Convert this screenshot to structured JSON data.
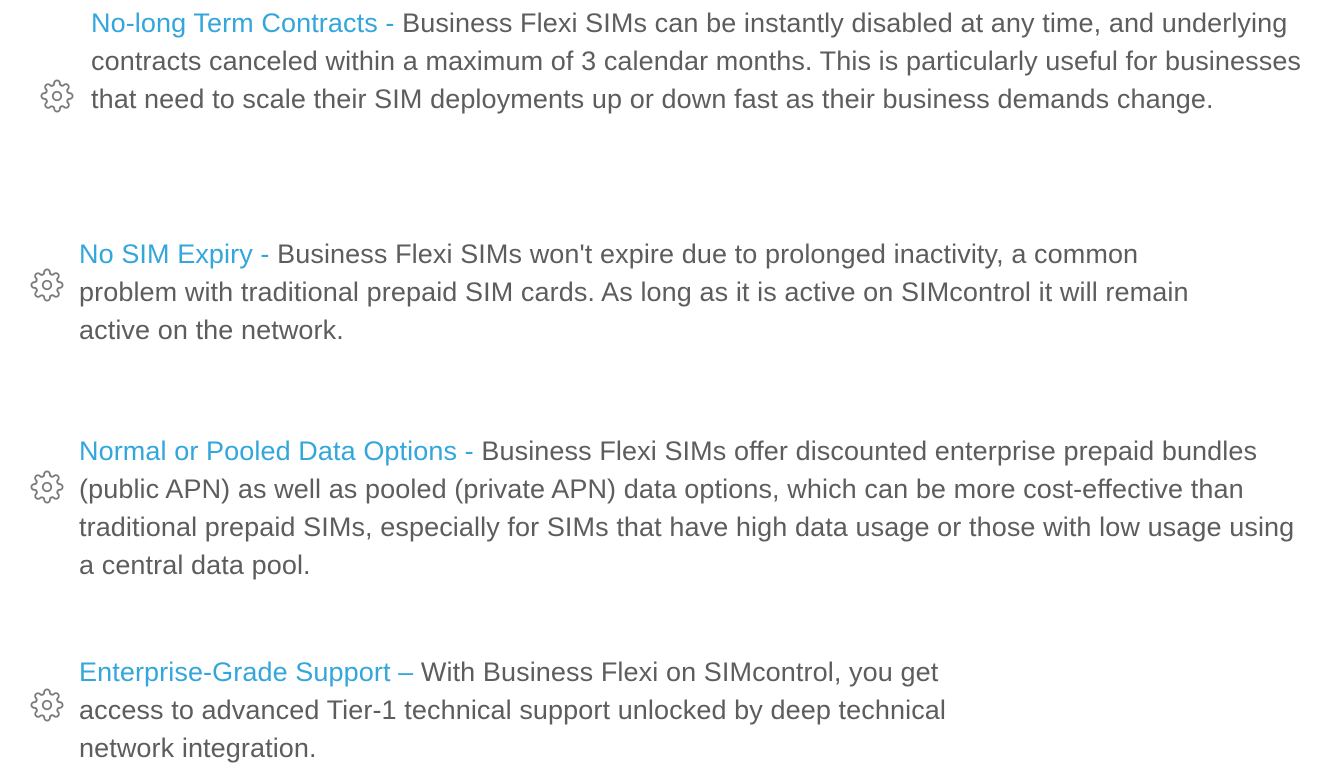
{
  "features": [
    {
      "icon": "gear-icon",
      "title": "No-long Term Contracts -",
      "body": " Business Flexi SIMs can be instantly disabled at any time, and underlying contracts canceled within a maximum of 3 calendar months. This is particularly useful for businesses that need to scale their SIM deployments up or down fast as their business demands change."
    },
    {
      "icon": "gear-icon",
      "title": "No SIM Expiry -",
      "body": " Business Flexi SIMs won't expire due to prolonged inactivity, a common problem with traditional prepaid SIM cards. As long as it is active on SIMcontrol it will remain active on the network."
    },
    {
      "icon": "gear-icon",
      "title": "Normal or Pooled Data Options -",
      "body": " Business Flexi SIMs offer discounted enterprise prepaid bundles (public APN) as well as pooled (private APN) data options, which can be more cost-effective than traditional prepaid SIMs, especially for SIMs that have high data usage or those with low usage using a central data pool."
    },
    {
      "icon": "gear-icon",
      "title": "Enterprise-Grade Support –",
      "body": " With Business Flexi on SIMcontrol, you get access to advanced Tier-1 technical support unlocked by deep technical network integration."
    }
  ],
  "colors": {
    "title": "#33a6db",
    "body": "#5d5d5d",
    "icon": "#7a7a7a"
  }
}
